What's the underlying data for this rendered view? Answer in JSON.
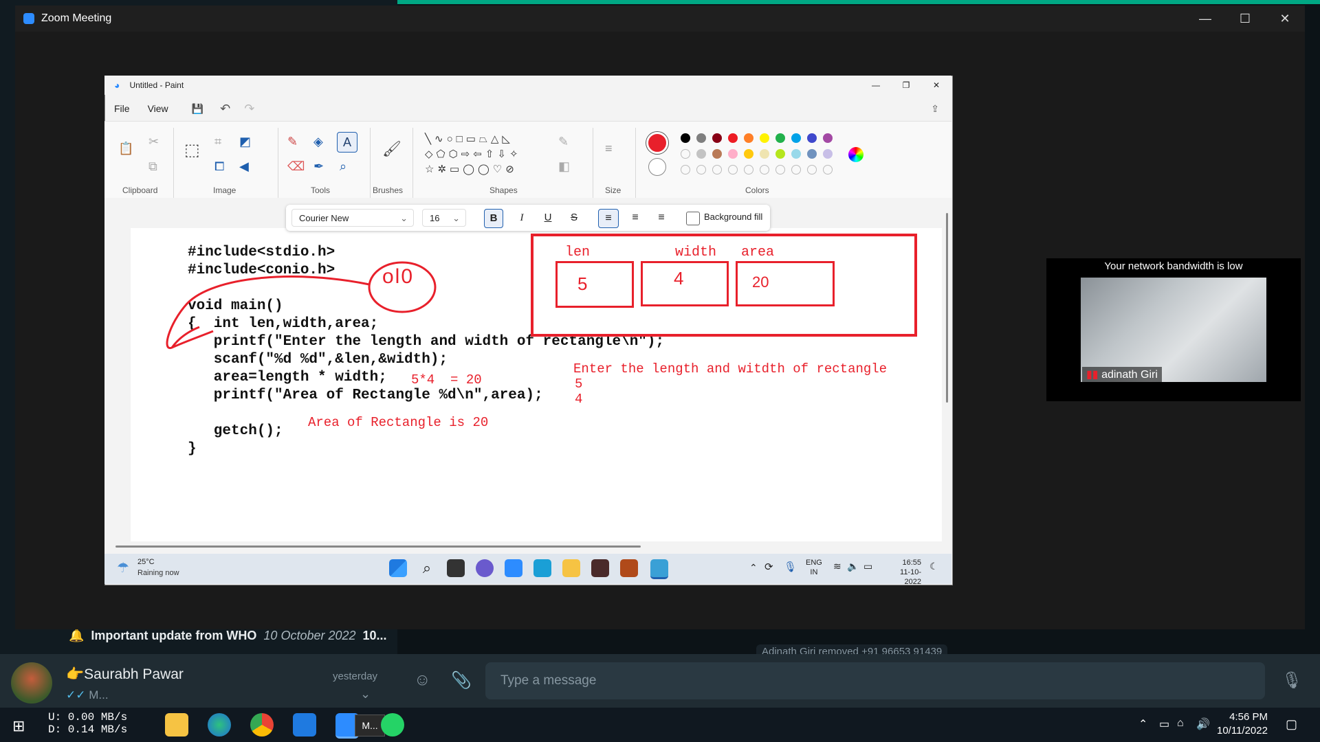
{
  "zoom": {
    "title": "Zoom Meeting"
  },
  "paint": {
    "title": "Untitled - Paint",
    "menu": [
      "File",
      "View"
    ],
    "groups": {
      "clipboard": "Clipboard",
      "image": "Image",
      "tools": "Tools",
      "brushes": "Brushes",
      "shapes": "Shapes",
      "size": "Size",
      "colors": "Colors"
    },
    "text_toolbar": {
      "font": "Courier New",
      "size": "16",
      "bold": "B",
      "italic": "I",
      "underline": "U",
      "strike": "S",
      "background_fill": "Background fill"
    },
    "colors_row1": [
      "#000000",
      "#7f7f7f",
      "#880015",
      "#ed1c24",
      "#ff7f27",
      "#fff200",
      "#22b14c",
      "#00a2e8",
      "#3f48cc",
      "#a349a4"
    ],
    "colors_row2": [
      "",
      "#c3c3c3",
      "#b97a57",
      "#ffaec9",
      "#ffc90e",
      "#efe4b0",
      "#b5e61d",
      "#99d9ea",
      "#7092be",
      "#c8bfe7"
    ],
    "primary_color": "#e8202b",
    "code_lines": [
      "#include<stdio.h>",
      "#include<conio.h>",
      "",
      "void main()",
      "{  int len,width,area;",
      "   printf(\"Enter the length and width of rectangle\\n\");",
      "   scanf(\"%d %d\",&len,&width);",
      "   area=length * width;",
      "   printf(\"Area of Rectangle %d\\n\",area);",
      "",
      "   getch();",
      "}"
    ],
    "annotations": {
      "circle_text": "ol0",
      "calc": "5*4  = 20",
      "output_area": "Area of Rectangle is 20",
      "output_prompt": "Enter the length and witdth of rectangle",
      "input1": "5",
      "input2": "4",
      "labels": [
        "len",
        "width",
        "area"
      ],
      "box_values": [
        "5",
        "4",
        "20"
      ]
    },
    "taskbar": {
      "weather_temp": "25°C",
      "weather_desc": "Raining now",
      "lang1": "ENG",
      "lang2": "IN",
      "time": "16:55",
      "date": "11-10-2022"
    }
  },
  "video": {
    "notice": "Your network bandwidth is low",
    "participant": "adinath Giri"
  },
  "whatsapp": {
    "notice_title": "Important update from WHO",
    "notice_date": "10 October 2022",
    "notice_more": "10...",
    "system_msg": "Adinath Giri removed +91 96653 91439",
    "chat_name": "Saurabh Pawar",
    "chat_time": "yesterday",
    "chat_preview": "M...",
    "input_placeholder": "Type a message"
  },
  "windows_taskbar": {
    "net_up": "U:   0.00 MB/s",
    "net_down": "D:   0.14 MB/s",
    "zoom_label": "M...",
    "time": "4:56 PM",
    "date": "10/11/2022"
  }
}
